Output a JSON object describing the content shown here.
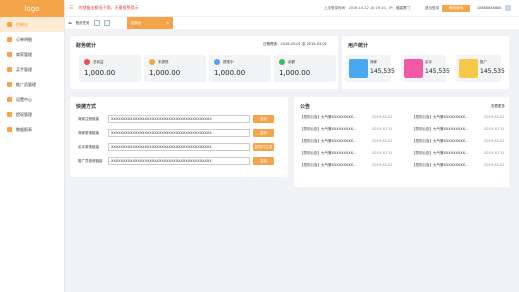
{
  "sidebar": {
    "logo": "logo",
    "items": [
      {
        "label": "控制台"
      },
      {
        "label": "订单明细"
      },
      {
        "label": "商家管理"
      },
      {
        "label": "买手管理"
      },
      {
        "label": "推广员管理"
      },
      {
        "label": "设置中心"
      },
      {
        "label": "提现管理"
      },
      {
        "label": "数据报表"
      }
    ]
  },
  "topbar": {
    "alert": "的储备金额低于哦，无需报警提示",
    "time": "上次登录时间：2019-10-12 10:19:10，IP：福建厦门",
    "link": "退出登录",
    "button": "修改密码",
    "phone": "18888888888"
  },
  "tabbar": {
    "first": "首页任务",
    "active": "控制台"
  },
  "finance": {
    "title": "财务统计",
    "date_range": "日期筛选：2019-03-01 至 2019-03-01",
    "stats": [
      {
        "label": "总收益",
        "value": "1,000.00",
        "color": "#f14c4c"
      },
      {
        "label": "未提现",
        "value": "1,000.00",
        "color": "#f6a44a"
      },
      {
        "label": "提现中",
        "value": "1,000.00",
        "color": "#5b9ef4"
      },
      {
        "label": "余额",
        "value": "1,000.00",
        "color": "#3fbb5a"
      }
    ]
  },
  "users": {
    "title": "用户统计",
    "stats": [
      {
        "label": "商家",
        "value": "145,535",
        "color": "#4aa8f0"
      },
      {
        "label": "买手",
        "value": "145,535",
        "color": "#f35aa6"
      },
      {
        "label": "推广",
        "value": "145,535",
        "color": "#f5c84a"
      }
    ]
  },
  "quick": {
    "title": "快捷方式",
    "rows": [
      {
        "label": "商家注册链接",
        "value": "XXXXXXXXXXXXXXXXXXXXXXXXXXXXXXXXXXXXXXXXXX",
        "btn": "复制"
      },
      {
        "label": "商家邀请链接",
        "value": "XXXXXXXXXXXXXXXXXXXXXXXXXXXXXXXXXXXXXXXXXX",
        "btn": "复制"
      },
      {
        "label": "买手邀请链接",
        "value": "XXXXXXXXXXXXXXXXXXXXXXXXXXXXXXXXXXXXXXXXXX",
        "btn": "复制并生成"
      },
      {
        "label": "推广员邀请链接",
        "value": "XXXXXXXXXXXXXXXXXXXXXXXXXXXXXXXXXXXXXXXXXX",
        "btn": "复制"
      }
    ]
  },
  "announce": {
    "title": "公告",
    "more": "查看更多",
    "items": [
      {
        "text": "【您的公告】大气第XXXXXXXXX…",
        "date": "2019-10-31"
      },
      {
        "text": "【您的公告】大气第XXXXXXXXX…",
        "date": "2019-10-31"
      },
      {
        "text": "【您的公告】大气第XXXXXXXXX…",
        "date": "2019-10-31"
      },
      {
        "text": "【您的公告】大气第XXXXXXXXX…",
        "date": "2019-10-31"
      },
      {
        "text": "【您的公告】大气第XXXXXXXXX…",
        "date": "2019-10-31"
      },
      {
        "text": "【您的公告】大气第XXXXXXXXX…",
        "date": "2019-10-31"
      },
      {
        "text": "【您的公告】大气第XXXXXXXXX…",
        "date": "2019-10-31"
      },
      {
        "text": "【您的公告】大气第XXXXXXXXX…",
        "date": "2019-10-31"
      },
      {
        "text": "【您的公告】大气第XXXXXXXXX…",
        "date": "2019-10-31"
      },
      {
        "text": "【您的公告】大气第XXXXXXXXX…",
        "date": "2019-10-31"
      }
    ]
  }
}
